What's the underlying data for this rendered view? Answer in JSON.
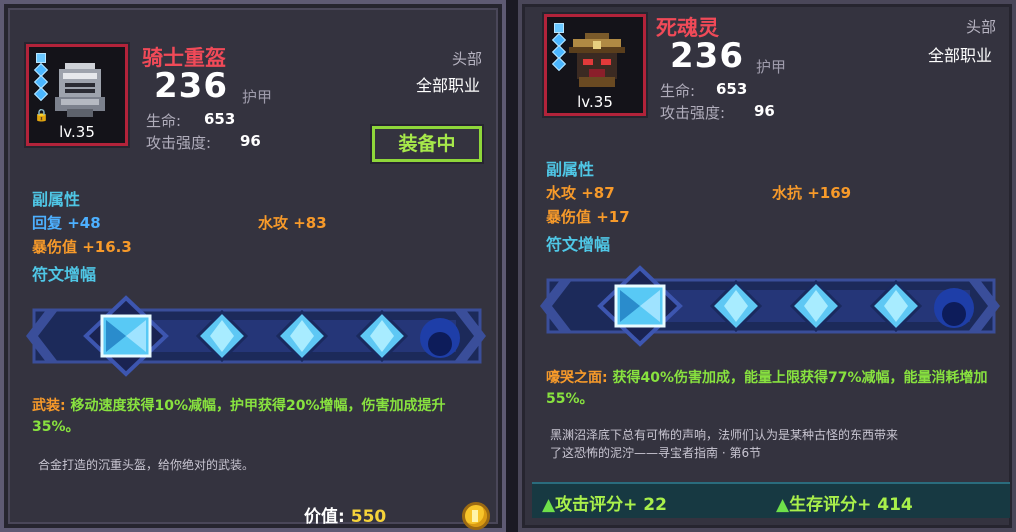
{
  "left_card": {
    "item_name": "骑士重盔",
    "level": "lv.35",
    "armor_value": "236",
    "armor_label": "护甲",
    "slot": "头部",
    "job": "全部职业",
    "stats": [
      {
        "label": "生命:",
        "value": "653"
      },
      {
        "label": "攻击强度:",
        "value": "96"
      }
    ],
    "equipped_label": "装备中",
    "sub_attr_title": "副属性",
    "sub_attrs": [
      {
        "text": "回复 +48",
        "color": "#4db0ff"
      },
      {
        "text": "水攻 +83",
        "color": "#f79a2a"
      },
      {
        "text": "暴伤值 +16.3",
        "color": "#f79a2a"
      }
    ],
    "rune_title": "符文增幅",
    "set_effect_name": "武装:",
    "set_effect_text": "移动速度获得10%减幅，护甲获得20%增幅，伤害加成提升35%。",
    "lore": "合金打造的沉重头盔，给你绝对的武装。",
    "value_label": "价值:",
    "value": "550",
    "icon": "knight-helmet-icon"
  },
  "right_card": {
    "item_name": "死魂灵",
    "level": "lv.35",
    "armor_value": "236",
    "armor_label": "护甲",
    "slot": "头部",
    "job": "全部职业",
    "stats": [
      {
        "label": "生命:",
        "value": "653"
      },
      {
        "label": "攻击强度:",
        "value": "96"
      }
    ],
    "sub_attr_title": "副属性",
    "sub_attrs": [
      {
        "text": "水攻 +87",
        "color": "#f79a2a"
      },
      {
        "text": "水抗 +169",
        "color": "#f79a2a"
      },
      {
        "text": "暴伤值 +17",
        "color": "#f79a2a"
      }
    ],
    "rune_title": "符文增幅",
    "set_effect_name": "嚎哭之面:",
    "set_effect_text": "获得40%伤害加成，能量上限获得77%减幅，能量消耗增加55%。",
    "lore_line1": "黑渊沼泽底下总有可怖的声响，法师们认为是某种古怪的东西带来",
    "lore_line2": "了这恐怖的泥泞——寻宝者指南 · 第6节",
    "attack_score": "攻击评分+ 22",
    "survival_score": "生存评分+ 414",
    "icon": "death-soul-helmet-icon"
  },
  "colors": {
    "name": "#f04a58",
    "section": "#4fc7e6",
    "effect_green": "#88e23f",
    "equipped_border": "#8fd73a",
    "coin": "#f7c52a"
  }
}
